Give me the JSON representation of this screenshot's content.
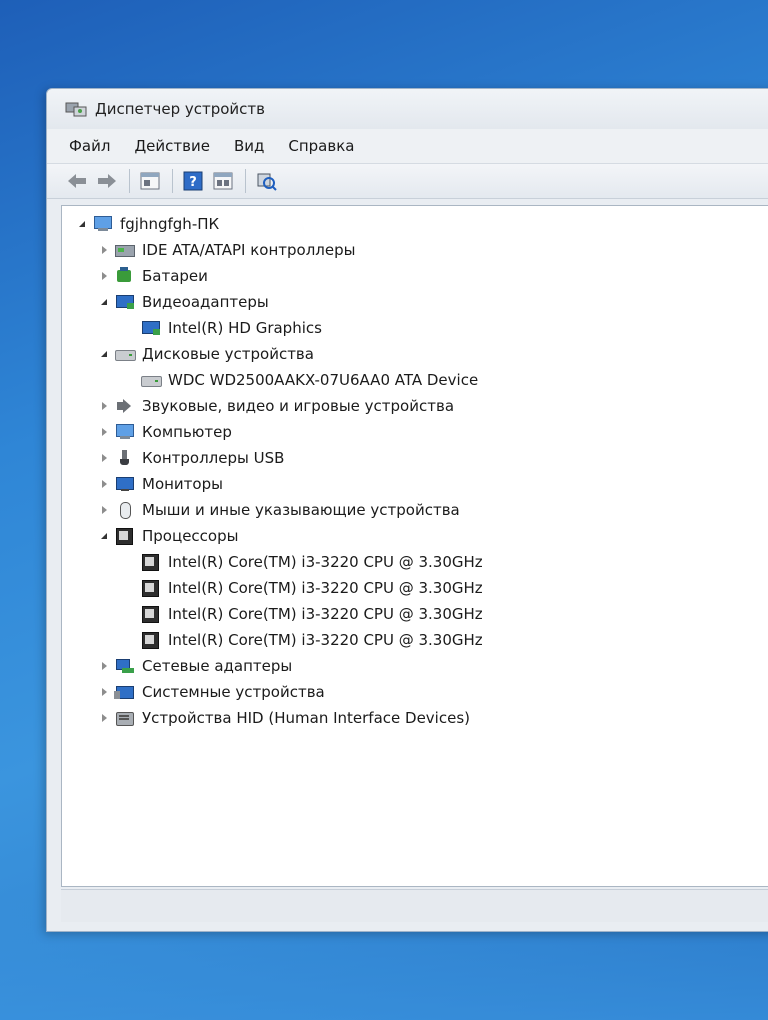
{
  "window": {
    "title": "Диспетчер устройств",
    "icon": "device-manager-icon"
  },
  "menu": [
    "Файл",
    "Действие",
    "Вид",
    "Справка"
  ],
  "toolbar": {
    "buttons": [
      "back-arrow-icon",
      "forward-arrow-icon",
      "show-hide-console-tree-icon",
      "help-icon",
      "properties-icon",
      "scan-hardware-icon"
    ]
  },
  "tree": {
    "root": {
      "label": "fgjhngfgh-ПК",
      "icon": "computer-icon",
      "state": "expanded"
    },
    "nodes": [
      {
        "label": "IDE ATA/ATAPI контроллеры",
        "icon": "ide-controller-icon",
        "state": "collapsed",
        "level": 1
      },
      {
        "label": "Батареи",
        "icon": "battery-icon",
        "state": "collapsed",
        "level": 1
      },
      {
        "label": "Видеоадаптеры",
        "icon": "display-adapter-icon",
        "state": "expanded",
        "level": 1
      },
      {
        "label": "Intel(R) HD Graphics",
        "icon": "display-adapter-icon",
        "state": "leaf",
        "level": 2
      },
      {
        "label": "Дисковые устройства",
        "icon": "disk-drive-icon",
        "state": "expanded",
        "level": 1
      },
      {
        "label": "WDC WD2500AAKX-07U6AA0 ATA Device",
        "icon": "disk-drive-icon",
        "state": "leaf",
        "level": 2
      },
      {
        "label": "Звуковые, видео и игровые устройства",
        "icon": "sound-icon",
        "state": "collapsed",
        "level": 1
      },
      {
        "label": "Компьютер",
        "icon": "computer-icon",
        "state": "collapsed",
        "level": 1
      },
      {
        "label": "Контроллеры USB",
        "icon": "usb-icon",
        "state": "collapsed",
        "level": 1
      },
      {
        "label": "Мониторы",
        "icon": "monitor-icon",
        "state": "collapsed",
        "level": 1
      },
      {
        "label": "Мыши и иные указывающие устройства",
        "icon": "mouse-icon",
        "state": "collapsed",
        "level": 1
      },
      {
        "label": "Процессоры",
        "icon": "processor-icon",
        "state": "expanded",
        "level": 1
      },
      {
        "label": "Intel(R) Core(TM) i3-3220 CPU @ 3.30GHz",
        "icon": "processor-icon",
        "state": "leaf",
        "level": 2
      },
      {
        "label": "Intel(R) Core(TM) i3-3220 CPU @ 3.30GHz",
        "icon": "processor-icon",
        "state": "leaf",
        "level": 2
      },
      {
        "label": "Intel(R) Core(TM) i3-3220 CPU @ 3.30GHz",
        "icon": "processor-icon",
        "state": "leaf",
        "level": 2
      },
      {
        "label": "Intel(R) Core(TM) i3-3220 CPU @ 3.30GHz",
        "icon": "processor-icon",
        "state": "leaf",
        "level": 2
      },
      {
        "label": "Сетевые адаптеры",
        "icon": "network-adapter-icon",
        "state": "collapsed",
        "level": 1
      },
      {
        "label": "Системные устройства",
        "icon": "system-devices-icon",
        "state": "collapsed",
        "level": 1
      },
      {
        "label": "Устройства HID (Human Interface Devices)",
        "icon": "hid-icon",
        "state": "collapsed",
        "level": 1
      }
    ]
  }
}
